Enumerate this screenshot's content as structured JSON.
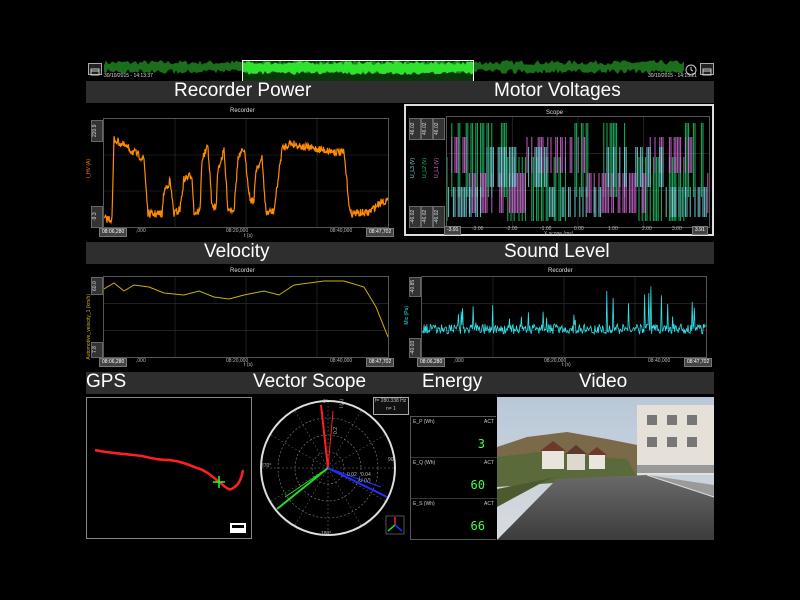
{
  "overview": {
    "start_time": "30/10/2015 - 14:13:37",
    "end_time": "30/10/2015 - 14:15:21"
  },
  "sections": {
    "recorder_power": "Recorder Power",
    "motor_voltages": "Motor Voltages",
    "velocity": "Velocity",
    "sound_level": "Sound Level",
    "gps": "GPS",
    "vector_scope": "Vector Scope",
    "energy": "Energy",
    "video": "Video"
  },
  "recorder_power_plot": {
    "title": "Recorder",
    "ylabel": "I_HV (A)",
    "ymax": "220.9",
    "ymin": "-9.3",
    "xlabel": "t (s)",
    "start": "08:06,280",
    "end": "08:47,702",
    "ticks": [
      ",000",
      "08:20,000",
      "08:40,000"
    ]
  },
  "motor_voltages_plot": {
    "title": "Scope",
    "ymax_labels": [
      "46.02",
      "46.02",
      "46.02"
    ],
    "ymin_labels": [
      "-46.02",
      "-46.02",
      "-46.02"
    ],
    "series_labels": [
      "U_L1 (V)",
      "U_L2 (V)",
      "U_L3 (V)"
    ],
    "xlabel": "X scope (ms)",
    "x_start": "-3.91",
    "x_end": "3.91",
    "ticks": [
      "-3.00",
      "-2.00",
      "-1.00",
      "0.00",
      "1.00",
      "2.00",
      "3.00"
    ]
  },
  "velocity_plot": {
    "title": "Recorder",
    "ylabel": "Automotive_velocity_1 (km/h)",
    "ymax": "60.0",
    "ymin": "7.8",
    "xlabel": "t (s)",
    "start": "08:06,280",
    "end": "08:47,702",
    "ticks": [
      ",000",
      "08:20,000",
      "08:40,000"
    ]
  },
  "sound_level_plot": {
    "title": "Recorder",
    "ylabel": "Mic (Pa)",
    "ymax": "-40.85",
    "ymin": "-40.03",
    "xlabel": "t (s)",
    "start": "08:06,280",
    "end": "08:47,702",
    "ticks": [
      ",000",
      "08:20,000",
      "08:40,000"
    ]
  },
  "vector_scope": {
    "freq": "f= 280.338 Hz",
    "harmonic": "n= 1",
    "angle_270": "270°",
    "angle_90": "90°",
    "angle_180": "180°",
    "angle_0": "0°",
    "label_i": "I (A)",
    "label_u": "U (V)",
    "scale_i": "0.2",
    "scale_u": "0.04",
    "scale_02": "0.02"
  },
  "energy": {
    "rows": [
      {
        "label": "E_P (Wh)",
        "act": "ACT",
        "value": "3"
      },
      {
        "label": "E_Q (Wh)",
        "act": "ACT",
        "value": "60"
      },
      {
        "label": "E_S (Wh)",
        "act": "ACT",
        "value": "66"
      }
    ]
  },
  "colors": {
    "power": "#ff8c00",
    "velocity": "#c8b400",
    "sound": "#33e0e8",
    "u_l1": "#e070e0",
    "u_l2": "#20d070",
    "u_l3": "#80e0e8",
    "gps_track": "#ff2020",
    "overview": "#22dd22"
  }
}
